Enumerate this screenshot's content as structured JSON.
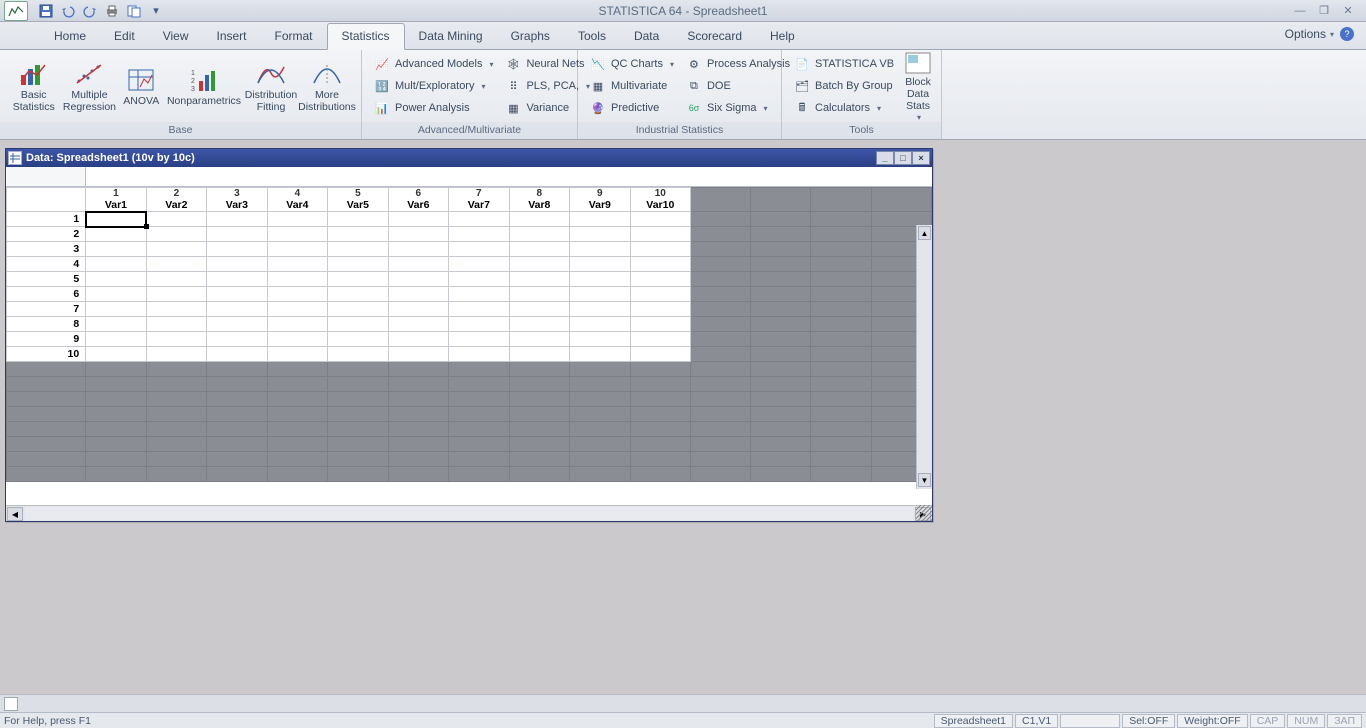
{
  "app": {
    "title": "STATISTICA 64 - Spreadsheet1",
    "options": "Options"
  },
  "menu": {
    "items": [
      "Home",
      "Edit",
      "View",
      "Insert",
      "Format",
      "Statistics",
      "Data Mining",
      "Graphs",
      "Tools",
      "Data",
      "Scorecard",
      "Help"
    ],
    "active": 5
  },
  "ribbon": {
    "base": {
      "label": "Base",
      "btns": [
        "Basic Statistics",
        "Multiple Regression",
        "ANOVA",
        "Nonparametrics",
        "Distribution Fitting",
        "More Distributions"
      ]
    },
    "adv": {
      "label": "Advanced/Multivariate",
      "col1": [
        "Advanced Models",
        "Mult/Exploratory",
        "Power Analysis"
      ],
      "col2": [
        "Neural Nets",
        "PLS, PCA,",
        "Variance"
      ]
    },
    "ind": {
      "label": "Industrial Statistics",
      "col1": [
        "QC Charts",
        "Multivariate",
        "Predictive"
      ],
      "col2": [
        "Process Analysis",
        "DOE",
        "Six Sigma"
      ]
    },
    "tools": {
      "label": "Tools",
      "col1": [
        "STATISTICA VB",
        "Batch By Group",
        "Calculators"
      ],
      "big": "Block Data Stats"
    }
  },
  "doc": {
    "title": "Data: Spreadsheet1 (10v by 10c)",
    "cols": [
      {
        "n": "1",
        "v": "Var1"
      },
      {
        "n": "2",
        "v": "Var2"
      },
      {
        "n": "3",
        "v": "Var3"
      },
      {
        "n": "4",
        "v": "Var4"
      },
      {
        "n": "5",
        "v": "Var5"
      },
      {
        "n": "6",
        "v": "Var6"
      },
      {
        "n": "7",
        "v": "Var7"
      },
      {
        "n": "8",
        "v": "Var8"
      },
      {
        "n": "9",
        "v": "Var9"
      },
      {
        "n": "10",
        "v": "Var10"
      }
    ],
    "rows": [
      "1",
      "2",
      "3",
      "4",
      "5",
      "6",
      "7",
      "8",
      "9",
      "10"
    ]
  },
  "status": {
    "help": "For Help, press F1",
    "sheet": "Spreadsheet1",
    "cell": "C1,V1",
    "sel": "Sel:OFF",
    "weight": "Weight:OFF",
    "cap": "CAP",
    "num": "NUM",
    "rec": "ЗАП"
  }
}
